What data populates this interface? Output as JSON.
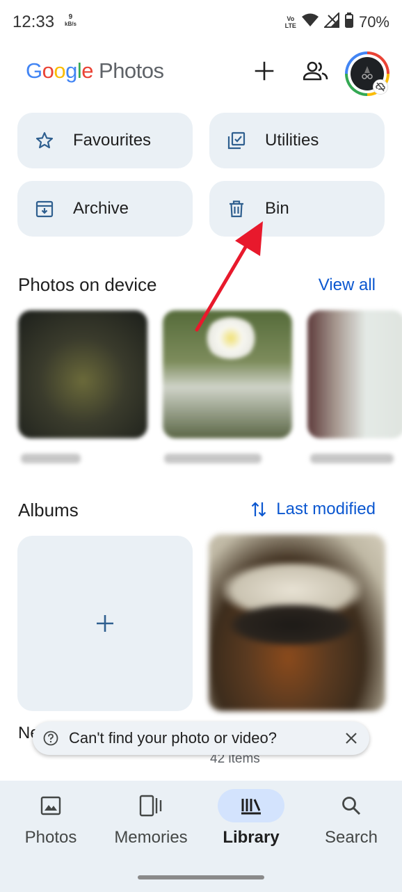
{
  "status_bar": {
    "time": "12:33",
    "net_speed_value": "9",
    "net_speed_unit": "kB/s",
    "volte_top": "Vo",
    "volte_bottom": "LTE",
    "battery": "70%"
  },
  "app_bar": {
    "logo_google": [
      "G",
      "o",
      "o",
      "g",
      "l",
      "e"
    ],
    "logo_google_colors": [
      "#4285f4",
      "#ea4335",
      "#fbbc05",
      "#4285f4",
      "#34a853",
      "#ea4335"
    ],
    "logo_photos": "Photos",
    "icons": [
      "add-icon",
      "shared-people-icon",
      "avatar"
    ]
  },
  "quick_tiles": [
    {
      "label": "Favourites",
      "icon": "star-icon"
    },
    {
      "label": "Utilities",
      "icon": "utilities-icon"
    },
    {
      "label": "Archive",
      "icon": "archive-icon"
    },
    {
      "label": "Bin",
      "icon": "bin-icon"
    }
  ],
  "device_section": {
    "title": "Photos on device",
    "link": "View all"
  },
  "albums_section": {
    "title": "Albums",
    "sort_label": "Last modified",
    "partial_album_title": "Ne",
    "album_count": "42 items"
  },
  "snackbar": {
    "text": "Can't find your photo or video?"
  },
  "bottom_nav": {
    "items": [
      {
        "label": "Photos",
        "icon": "photo-icon",
        "active": false
      },
      {
        "label": "Memories",
        "icon": "memories-icon",
        "active": false
      },
      {
        "label": "Library",
        "icon": "library-icon",
        "active": true
      },
      {
        "label": "Search",
        "icon": "search-icon",
        "active": false
      }
    ]
  },
  "colors": {
    "accent": "#0b57d0",
    "tile_bg": "#eaf0f5",
    "nav_active_pill": "#d3e3fd",
    "annotation_arrow": "#e8192c"
  }
}
